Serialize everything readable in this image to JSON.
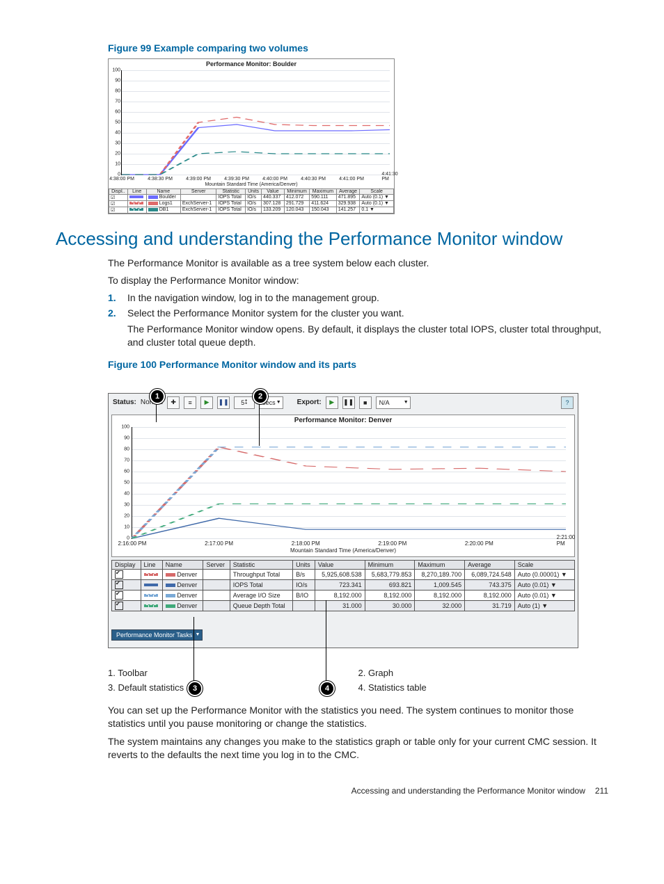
{
  "figure99": {
    "caption": "Figure 99 Example comparing two volumes",
    "chart_title": "Performance Monitor: Boulder",
    "x_axis_title": "Mountain Standard Time (America/Denver)",
    "y_ticks": [
      "0",
      "10",
      "20",
      "30",
      "40",
      "50",
      "60",
      "70",
      "80",
      "90",
      "100"
    ],
    "x_ticks": [
      "4:38:00 PM",
      "4:38:30 PM",
      "4:39:00 PM",
      "4:39:30 PM",
      "4:40:00 PM",
      "4:40:30 PM",
      "4:41:00 PM",
      "4:41:30 PM"
    ],
    "table_headers": [
      "Displ..",
      "Line",
      "Name",
      "Server",
      "Statistic",
      "Units",
      "Value",
      "Minimum",
      "Maximum",
      "Average",
      "Scale"
    ],
    "rows": [
      {
        "checked": true,
        "line_color": "#6b6bff",
        "line_style": "solid",
        "name": "Boulder",
        "server": "",
        "stat": "IOPS Total",
        "units": "IO/s",
        "value": "440.337",
        "min": "412.072",
        "max": "590.111",
        "avg": "471.895",
        "scale": "Auto (0.1) ▼"
      },
      {
        "checked": true,
        "line_color": "#e06a6a",
        "line_style": "dashed",
        "name": "Logs1",
        "server": "ExchServer-1",
        "stat": "IOPS Total",
        "units": "IO/s",
        "value": "307.128",
        "min": "291.729",
        "max": "411.624",
        "avg": "329.938",
        "scale": "Auto (0.1) ▼"
      },
      {
        "checked": true,
        "line_color": "#2a8a8a",
        "line_style": "dashed",
        "name": "DB1",
        "server": "ExchServer-1",
        "stat": "IOPS Total",
        "units": "IO/s",
        "value": "133.209",
        "min": "120.043",
        "max": "150.043",
        "avg": "141.257",
        "scale": "0.1 ▼"
      }
    ]
  },
  "section": {
    "heading": "Accessing and understanding the Performance Monitor window",
    "p1": "The Performance Monitor is available as a tree system below each cluster.",
    "p2": "To display the Performance Monitor window:",
    "step1": "In the navigation window, log in to the management group.",
    "step2": "Select the Performance Monitor system for the cluster you want.",
    "step2b": "The Performance Monitor window opens. By default, it displays the cluster total IOPS, cluster total throughput, and cluster total queue depth."
  },
  "figure100": {
    "caption": "Figure 100 Performance Monitor window and its parts",
    "status_label": "Status:",
    "status_value": "Normal",
    "spin_value": "5",
    "interval_unit": "secs",
    "export_label": "Export:",
    "export_dest": "N/A",
    "chart_title": "Performance Monitor: Denver",
    "x_axis_title": "Mountain Standard Time (America/Denver)",
    "y_ticks": [
      "0",
      "10",
      "20",
      "30",
      "40",
      "50",
      "60",
      "70",
      "80",
      "90",
      "100"
    ],
    "x_ticks": [
      "2:16:00 PM",
      "2:17:00 PM",
      "2:18:00 PM",
      "2:19:00 PM",
      "2:20:00 PM",
      "2:21:00 PM"
    ],
    "table_headers": [
      "Display",
      "Line",
      "Name",
      "Server",
      "Statistic",
      "Units",
      "Value",
      "Minimum",
      "Maximum",
      "Average",
      "Scale"
    ],
    "rows": [
      {
        "checked": true,
        "line_color": "#d66a6a",
        "line_style": "dashed",
        "name": "Denver",
        "server": "",
        "stat": "Throughput Total",
        "units": "B/s",
        "value": "5,925,608.538",
        "min": "5,683,779.853",
        "max": "8,270,189.700",
        "avg": "6,089,724.548",
        "scale": "Auto (0.00001) ▼"
      },
      {
        "checked": true,
        "line_color": "#3f69a9",
        "line_style": "solid",
        "name": "Denver",
        "server": "",
        "stat": "IOPS Total",
        "units": "IO/s",
        "value": "723.341",
        "min": "693.821",
        "max": "1,009.545",
        "avg": "743.375",
        "scale": "Auto (0.01) ▼"
      },
      {
        "checked": true,
        "line_color": "#7aa9d6",
        "line_style": "dashed",
        "name": "Denver",
        "server": "",
        "stat": "Average I/O Size",
        "units": "B/IO",
        "value": "8,192.000",
        "min": "8,192.000",
        "max": "8,192.000",
        "avg": "8,192.000",
        "scale": "Auto (0.01) ▼"
      },
      {
        "checked": true,
        "line_color": "#3fa97a",
        "line_style": "dashed",
        "name": "Denver",
        "server": "",
        "stat": "Queue Depth Total",
        "units": "",
        "value": "31.000",
        "min": "30.000",
        "max": "32.000",
        "avg": "31.719",
        "scale": "Auto (1) ▼"
      }
    ],
    "tasks_btn": "Performance Monitor Tasks",
    "legend": {
      "1": "Toolbar",
      "2": "Graph",
      "3": "Default statistics",
      "4": "Statistics table"
    }
  },
  "closing": {
    "p1": "You can set up the Performance Monitor with the statistics you need. The system continues to monitor those statistics until you pause monitoring or change the statistics.",
    "p2": "The system maintains any changes you make to the statistics graph or table only for your current CMC session. It reverts to the defaults the next time you log in to the CMC."
  },
  "footer": {
    "text": "Accessing and understanding the Performance Monitor window",
    "page": "211"
  },
  "chart_data": [
    {
      "type": "line",
      "title": "Performance Monitor: Boulder",
      "xlabel": "Mountain Standard Time (America/Denver)",
      "ylabel": "",
      "ylim": [
        0,
        100
      ],
      "x": [
        "4:38:00",
        "4:38:30",
        "4:39:00",
        "4:39:30",
        "4:40:00",
        "4:40:30",
        "4:41:00",
        "4:41:30"
      ],
      "series": [
        {
          "name": "Boulder IOPS Total (×0.1)",
          "values": [
            0,
            0,
            45,
            48,
            42,
            42,
            42,
            43
          ]
        },
        {
          "name": "Logs1 IOPS Total (×0.1)",
          "values": [
            0,
            0,
            50,
            55,
            48,
            47,
            47,
            47
          ]
        },
        {
          "name": "DB1 IOPS Total (×0.1)",
          "values": [
            0,
            0,
            20,
            22,
            20,
            20,
            20,
            20
          ]
        }
      ]
    },
    {
      "type": "line",
      "title": "Performance Monitor: Denver",
      "xlabel": "Mountain Standard Time (America/Denver)",
      "ylabel": "",
      "ylim": [
        0,
        100
      ],
      "x": [
        "2:16:00",
        "2:17:00",
        "2:18:00",
        "2:19:00",
        "2:20:00",
        "2:21:00"
      ],
      "series": [
        {
          "name": "Throughput Total (×0.00001)",
          "values": [
            0,
            82,
            65,
            62,
            63,
            60
          ]
        },
        {
          "name": "IOPS Total (×0.01)",
          "values": [
            0,
            18,
            8,
            8,
            8,
            8
          ]
        },
        {
          "name": "Average I/O Size (×0.01)",
          "values": [
            0,
            82,
            82,
            82,
            82,
            82
          ]
        },
        {
          "name": "Queue Depth Total (×1)",
          "values": [
            0,
            31,
            31,
            31,
            31,
            31
          ]
        }
      ]
    }
  ]
}
